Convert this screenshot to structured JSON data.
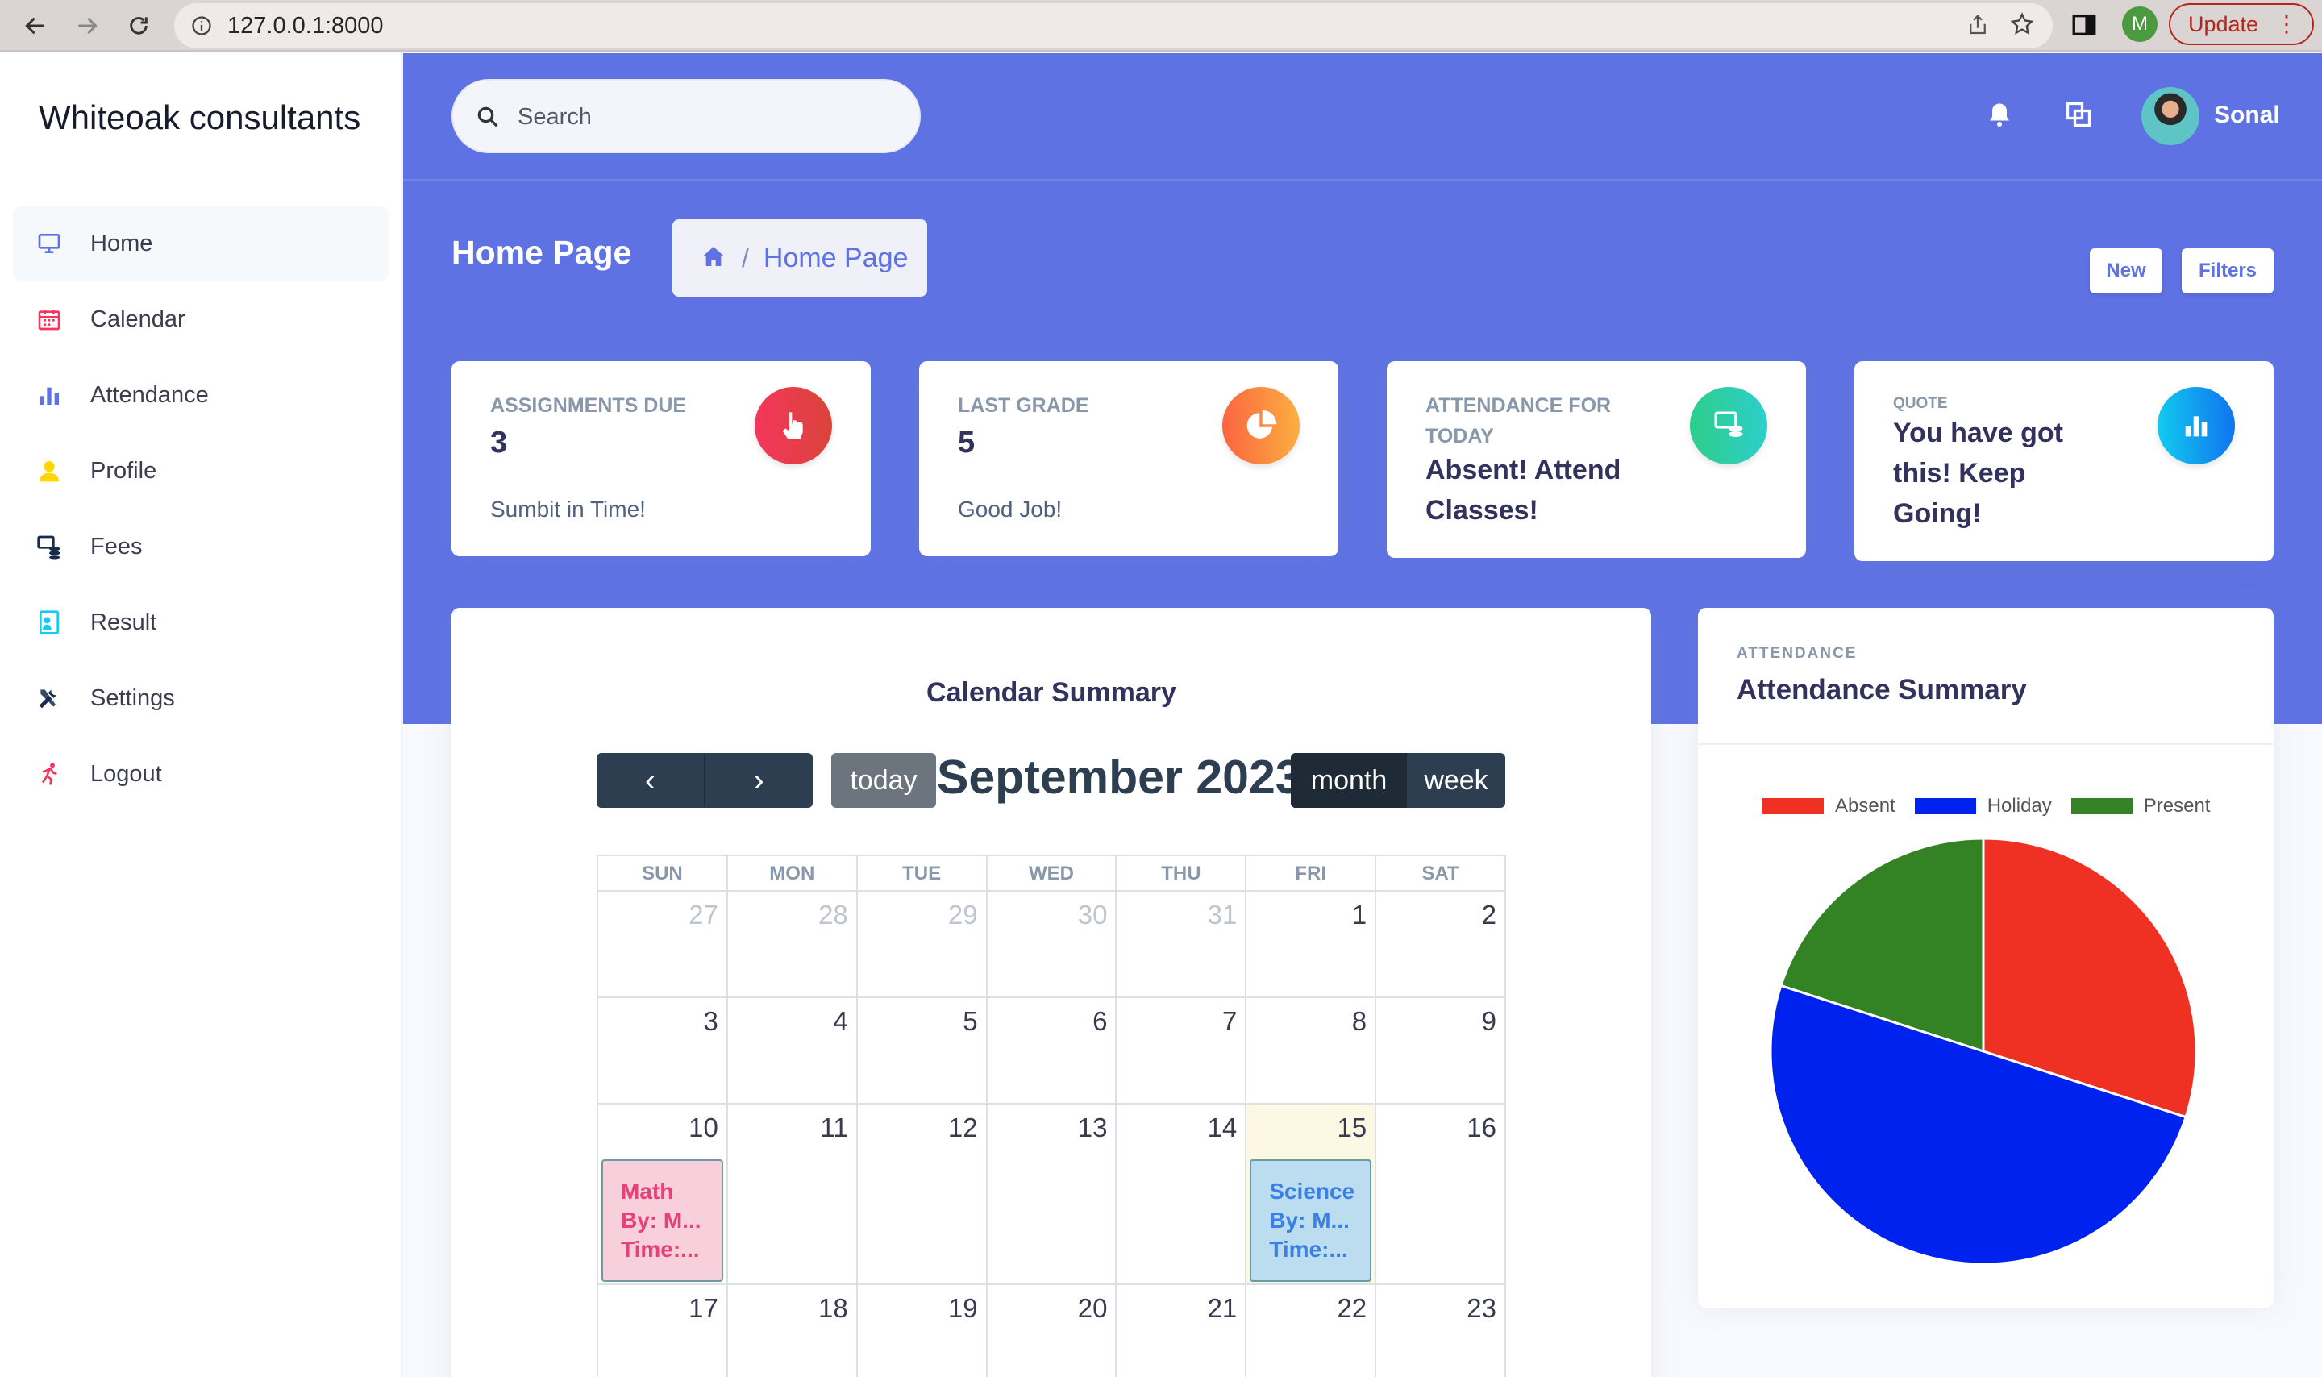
{
  "browser": {
    "url": "127.0.0.1:8000",
    "profile_initial": "M",
    "update_label": "Update"
  },
  "sidebar": {
    "brand": "Whiteoak consultants",
    "items": [
      {
        "label": "Home",
        "icon": "monitor-icon",
        "color": "#5e72e4"
      },
      {
        "label": "Calendar",
        "icon": "calendar-icon",
        "color": "#f5365c"
      },
      {
        "label": "Attendance",
        "icon": "bar-chart-icon",
        "color": "#5e72e4"
      },
      {
        "label": "Profile",
        "icon": "user-icon",
        "color": "#ffd600"
      },
      {
        "label": "Fees",
        "icon": "coins-icon",
        "color": "#172b4d"
      },
      {
        "label": "Result",
        "icon": "id-card-icon",
        "color": "#11cdef"
      },
      {
        "label": "Settings",
        "icon": "tools-icon",
        "color": "#172b4d"
      },
      {
        "label": "Logout",
        "icon": "running-icon",
        "color": "#f5365c"
      }
    ]
  },
  "header": {
    "search_placeholder": "Search",
    "user_name": "Sonal",
    "page_title": "Home Page",
    "breadcrumb": "Home Page",
    "new_label": "New",
    "filters_label": "Filters"
  },
  "stats": [
    {
      "caption": "Assignments Due",
      "value": "3",
      "sub": "Sumbit in Time!",
      "icon": "hand-pointer-icon",
      "color": "#e6404f"
    },
    {
      "caption": "Last Grade",
      "value": "5",
      "sub": "Good Job!",
      "icon": "pie-chart-icon",
      "color": "#f5704a"
    },
    {
      "caption": "Attendance for today",
      "value": "Absent! Attend Classes!",
      "sub": "",
      "icon": "money-check-icon",
      "color": "#2dce89"
    },
    {
      "caption": "Quote",
      "value": "You have got this! Keep Going!",
      "sub": "",
      "icon": "bar-chart-icon",
      "color": "#11cdef"
    }
  ],
  "calendar": {
    "title": "Calendar Summary",
    "prev": "‹",
    "next": "›",
    "today_label": "today",
    "month_label": "September 2023",
    "view_month": "month",
    "view_week": "week",
    "weekdays": [
      "SUN",
      "MON",
      "TUE",
      "WED",
      "THU",
      "FRI",
      "SAT"
    ],
    "weeks": [
      [
        "27",
        "28",
        "29",
        "30",
        "31",
        "1",
        "2"
      ],
      [
        "3",
        "4",
        "5",
        "6",
        "7",
        "8",
        "9"
      ],
      [
        "10",
        "11",
        "12",
        "13",
        "14",
        "15",
        "16"
      ],
      [
        "17",
        "18",
        "19",
        "20",
        "21",
        "22",
        "23"
      ]
    ],
    "events": [
      {
        "lines": [
          "Math",
          "By: M...",
          "Time:..."
        ]
      },
      {
        "lines": [
          "Science",
          "By: M...",
          "Time:..."
        ]
      }
    ]
  },
  "attendance": {
    "caption": "ATTENDANCE",
    "title": "Attendance Summary"
  },
  "chart_data": {
    "type": "pie",
    "title": "",
    "categories": [
      "Absent",
      "Holiday",
      "Present"
    ],
    "values": [
      30,
      50,
      20
    ],
    "colors": [
      "#ef3124",
      "#0022ee",
      "#338223"
    ],
    "legend": "top"
  }
}
